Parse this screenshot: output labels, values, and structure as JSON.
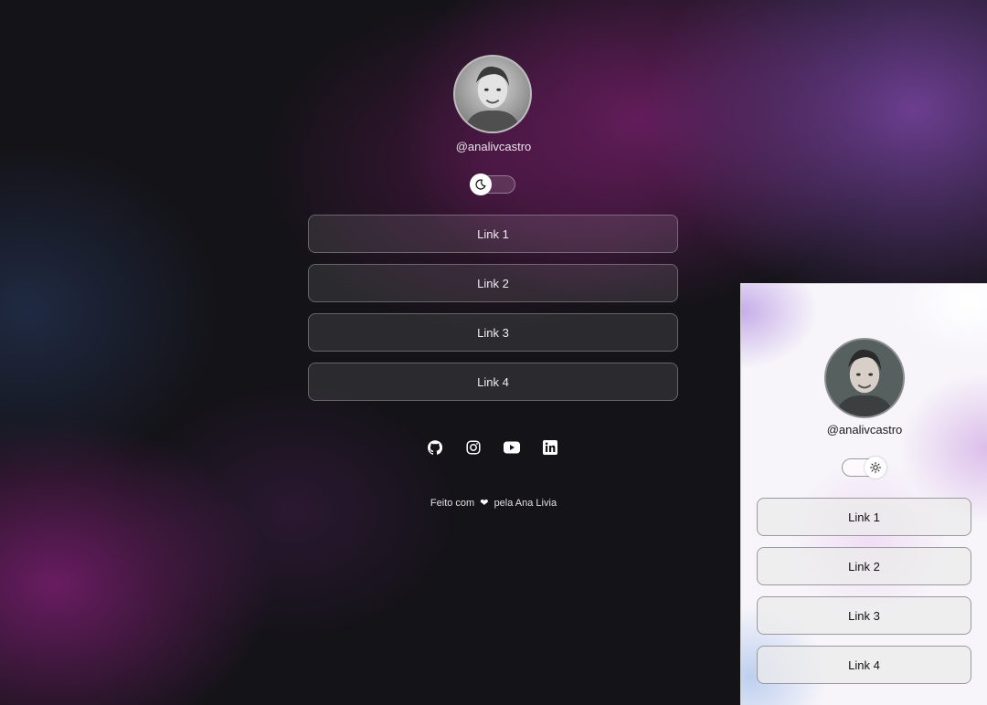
{
  "dark": {
    "username": "@analivcastro",
    "toggle_icon": "moon-icon",
    "links": [
      {
        "label": "Link 1"
      },
      {
        "label": "Link 2"
      },
      {
        "label": "Link 3"
      },
      {
        "label": "Link 4"
      }
    ],
    "social": [
      "github-icon",
      "instagram-icon",
      "youtube-icon",
      "linkedin-icon"
    ],
    "footer": {
      "before": "Feito com",
      "heart": "❤",
      "after": "pela Ana Livia"
    }
  },
  "light": {
    "username": "@analivcastro",
    "toggle_icon": "sun-icon",
    "links": [
      {
        "label": "Link 1"
      },
      {
        "label": "Link 2"
      },
      {
        "label": "Link 3"
      },
      {
        "label": "Link 4"
      }
    ]
  },
  "colors": {
    "dark_bg": "#141318",
    "accent_purple": "#6e1e64",
    "light_bg": "#f7f5fa"
  }
}
